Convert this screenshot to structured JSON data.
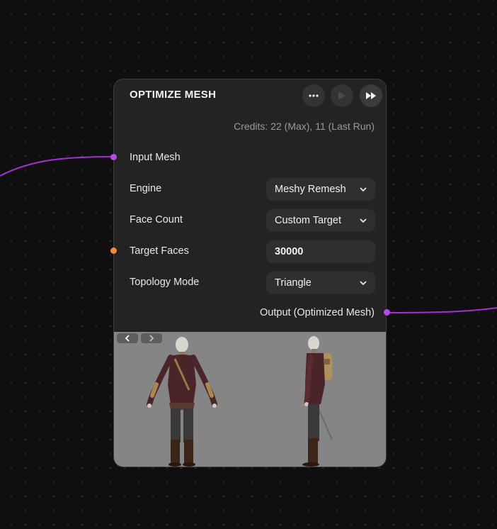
{
  "node": {
    "title": "OPTIMIZE MESH",
    "credits": "Credits: 22 (Max), 11 (Last Run)",
    "toolbar": {
      "more_icon": "more-horizontal-icon",
      "run_icon": "play-icon",
      "run_all_icon": "fast-forward-icon"
    },
    "input": {
      "label": "Input Mesh"
    },
    "params": [
      {
        "label": "Engine",
        "value": "Meshy Remesh",
        "type": "select"
      },
      {
        "label": "Face Count",
        "value": "Custom Target",
        "type": "select"
      },
      {
        "label": "Target Faces",
        "value": "30000",
        "type": "number"
      },
      {
        "label": "Topology Mode",
        "value": "Triangle",
        "type": "select"
      }
    ],
    "output": {
      "label": "Output (Optimized Mesh)"
    },
    "preview": {
      "prev_icon": "chevron-left-icon",
      "next_icon": "chevron-right-icon"
    }
  },
  "colors": {
    "wire": "#a42ed8",
    "input_port": "#b44be6",
    "param_port": "#f08a3c",
    "output_port": "#b44be6",
    "node_bg": "#232323",
    "preview_bg": "#858585"
  }
}
